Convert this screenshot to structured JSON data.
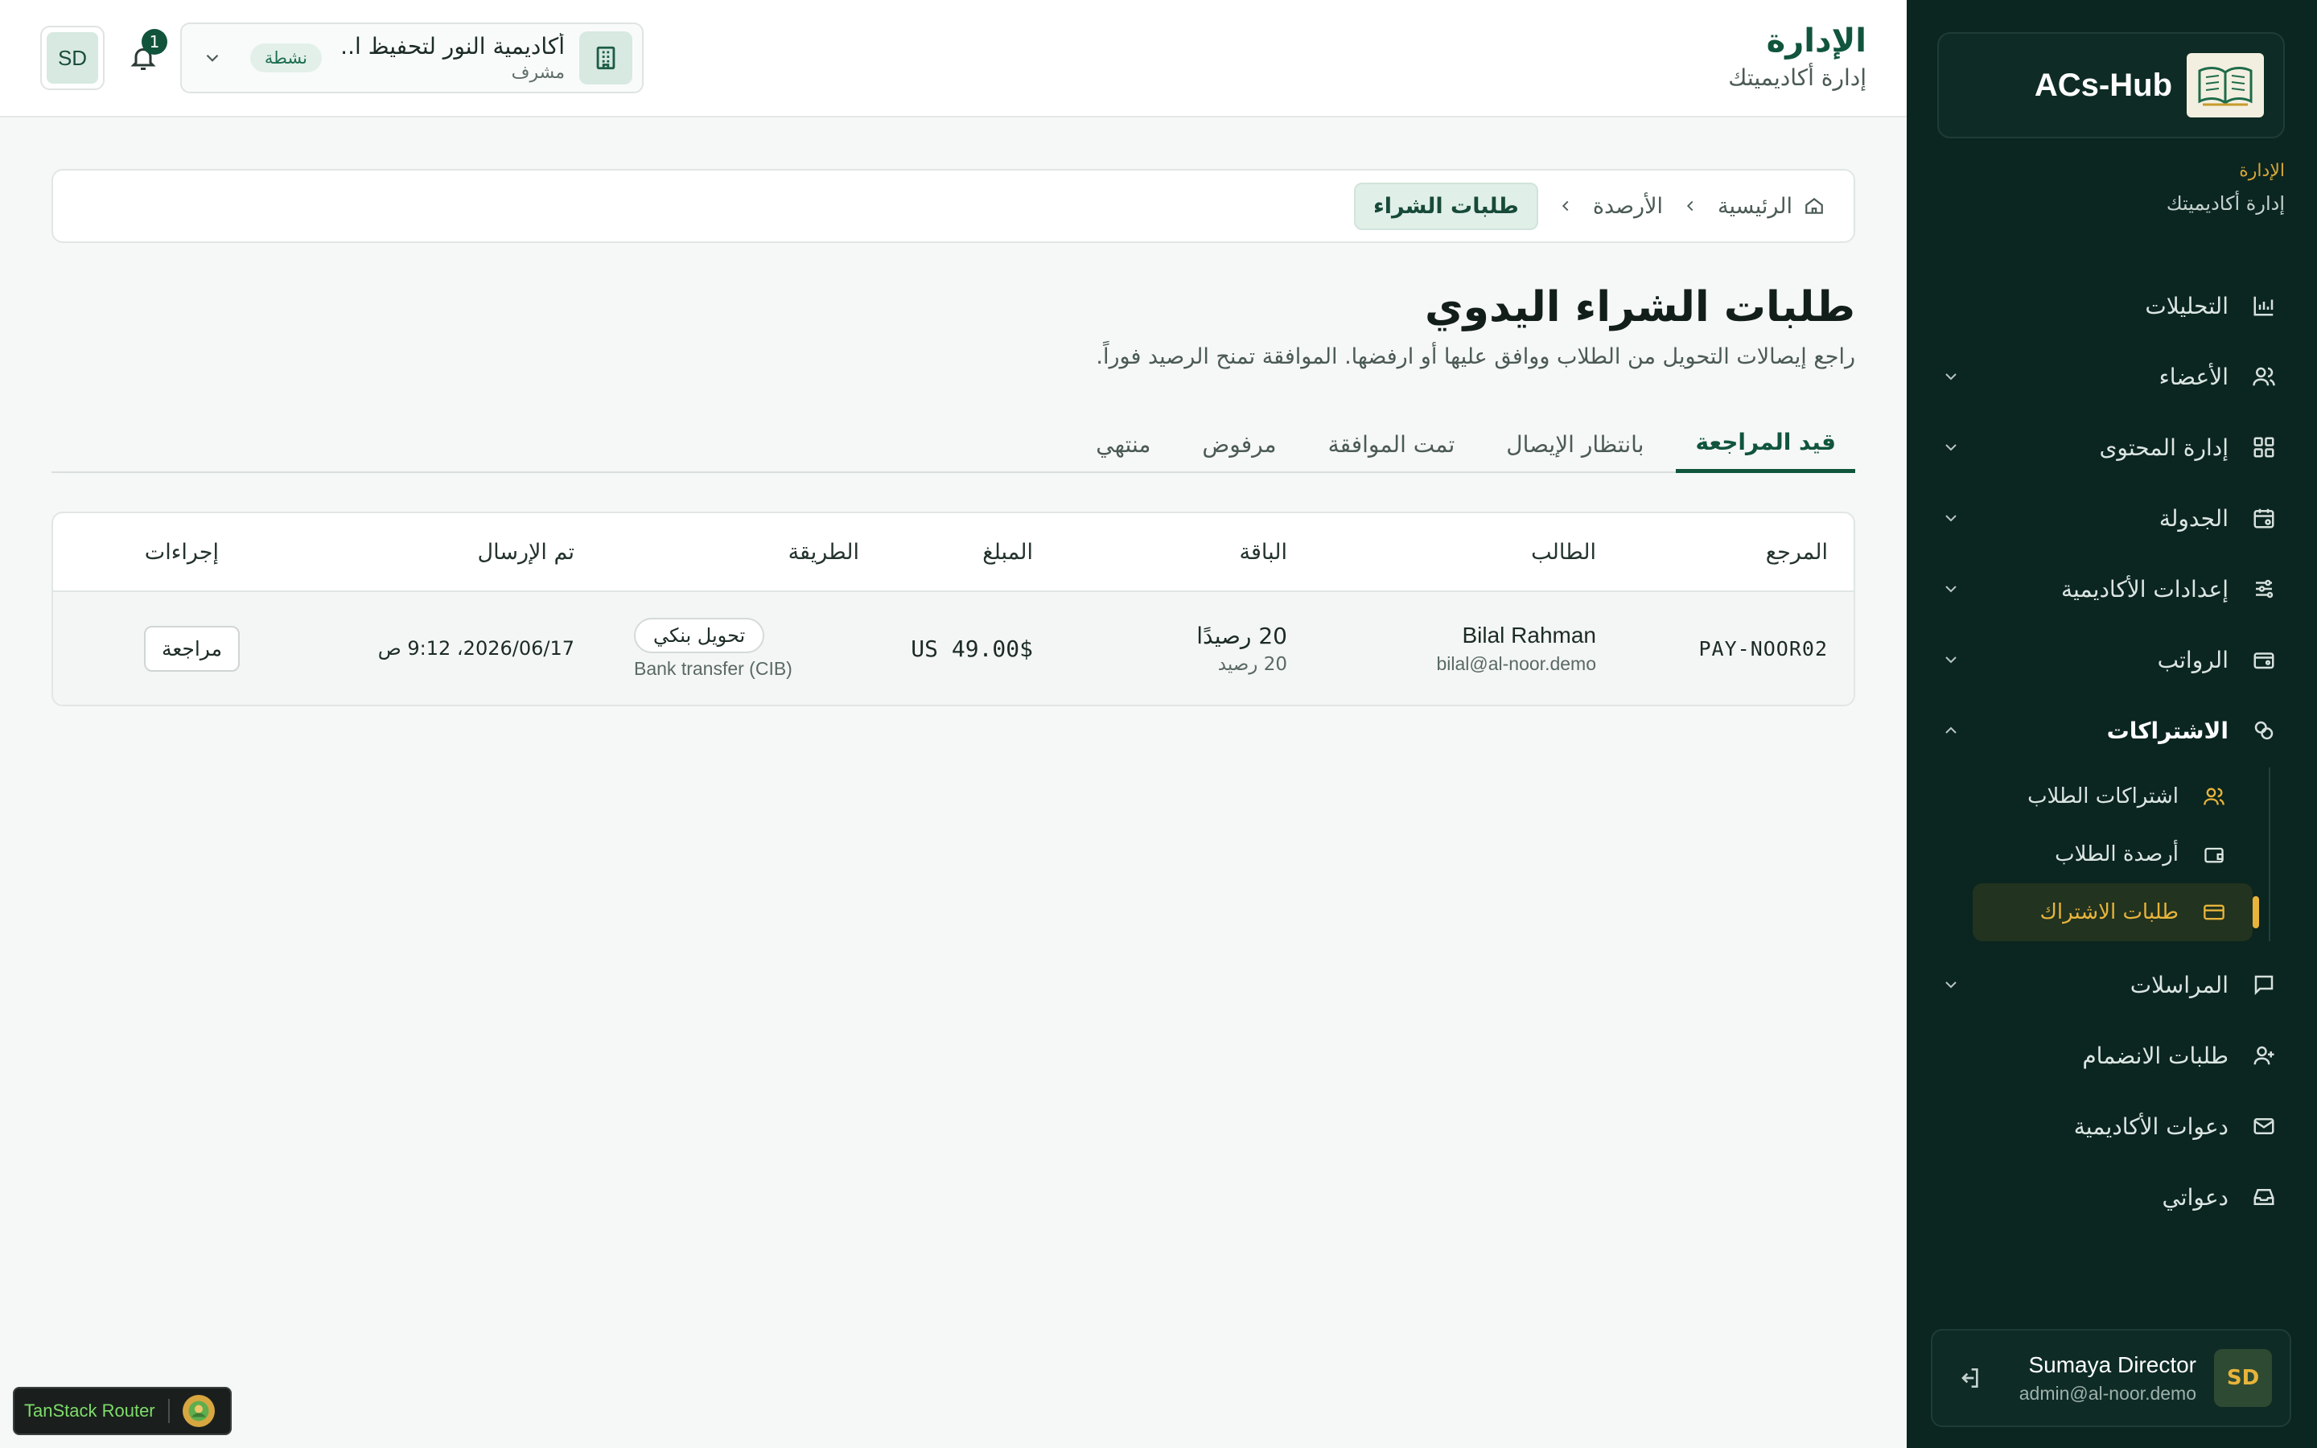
{
  "sidebar": {
    "brand": "ACs-Hub",
    "section_label": "الإدارة",
    "section_sub": "إدارة أكاديميتك",
    "nav": [
      {
        "label": "التحليلات",
        "icon": "analytics-icon",
        "chevron": false
      },
      {
        "label": "الأعضاء",
        "icon": "users-icon",
        "chevron": true
      },
      {
        "label": "إدارة المحتوى",
        "icon": "grid-icon",
        "chevron": true
      },
      {
        "label": "الجدولة",
        "icon": "calendar-icon",
        "chevron": true
      },
      {
        "label": "إعدادات الأكاديمية",
        "icon": "sliders-icon",
        "chevron": true
      },
      {
        "label": "الرواتب",
        "icon": "wallet-icon",
        "chevron": true
      },
      {
        "label": "الاشتراكات",
        "icon": "subscriptions-icon",
        "chevron": true,
        "expanded": true
      }
    ],
    "sub": [
      {
        "label": "اشتراكات الطلاب",
        "icon": "users-icon"
      },
      {
        "label": "أرصدة الطلاب",
        "icon": "wallet-icon"
      },
      {
        "label": "طلبات الاشتراك",
        "icon": "card-icon",
        "current": true
      }
    ],
    "nav_after": [
      {
        "label": "المراسلات",
        "icon": "chat-icon",
        "chevron": true
      },
      {
        "label": "طلبات الانضمام",
        "icon": "user-plus-icon",
        "chevron": false
      },
      {
        "label": "دعوات الأكاديمية",
        "icon": "mail-icon",
        "chevron": false
      },
      {
        "label": "دعواتي",
        "icon": "inbox-icon",
        "chevron": false
      }
    ],
    "user": {
      "initials": "SD",
      "name": "Sumaya Director",
      "email": "admin@al-noor.demo"
    }
  },
  "header": {
    "title": "الإدارة",
    "subtitle": "إدارة أكاديميتك",
    "academy": {
      "name": "أكاديمية النور لتحفيظ ا...",
      "role": "مشرف",
      "status": "نشطة"
    },
    "notifications": "1",
    "avatar": "SD"
  },
  "breadcrumb": {
    "home": "الرئيسية",
    "balances": "الأرصدة",
    "current": "طلبات الشراء"
  },
  "page": {
    "title": "طلبات الشراء اليدوي",
    "description": "راجع إيصالات التحويل من الطلاب ووافق عليها أو ارفضها. الموافقة تمنح الرصيد فوراً."
  },
  "tabs": [
    "قيد المراجعة",
    "بانتظار الإيصال",
    "تمت الموافقة",
    "مرفوض",
    "منتهي"
  ],
  "table": {
    "headers": {
      "reference": "المرجع",
      "student": "الطالب",
      "package": "الباقة",
      "amount": "المبلغ",
      "method": "الطريقة",
      "sent": "تم الإرسال",
      "actions": "إجراءات"
    },
    "rows": [
      {
        "reference": "PAY-NOOR02",
        "student_name": "Bilal Rahman",
        "student_email": "bilal@al-noor.demo",
        "package_title": "20 رصيدًا",
        "package_sub": "20 رصيد",
        "amount": "$US 49.00",
        "method": "تحويل بنكي",
        "method_sub": "Bank transfer (CIB)",
        "sent": "2026/06/17، 9:12 ص",
        "action": "مراجعة"
      }
    ]
  },
  "devtools": {
    "label": "TanStack Router"
  },
  "colors": {
    "sidebar_bg": "#0b2520",
    "accent_gold": "#e8b43b",
    "primary_green": "#10553c"
  }
}
